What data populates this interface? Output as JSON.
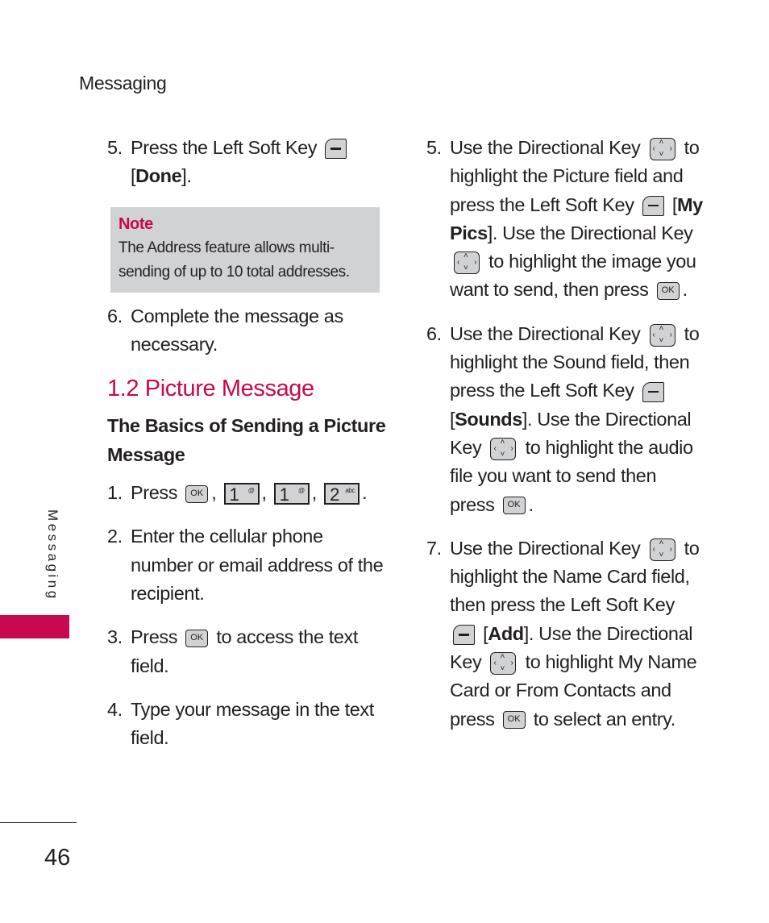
{
  "header": {
    "title": "Messaging"
  },
  "left_column": {
    "step5": {
      "num": "5.",
      "text_a": "Press the Left Soft Key",
      "bracket_open": "[",
      "label": "Done",
      "bracket_close": "]."
    },
    "note": {
      "title": "Note",
      "text": "The Address feature allows multi-sending of up to 10 total addresses."
    },
    "step6": {
      "num": "6.",
      "text": "Complete the message as necessary."
    },
    "section_title": "1.2 Picture Message",
    "subsection_title": "The Basics of Sending a Picture Message",
    "step1": {
      "num": "1.",
      "text": "Press",
      "sep": ",",
      "end": "."
    },
    "step2": {
      "num": "2.",
      "text": "Enter the cellular phone number or email address of the recipient."
    },
    "step3": {
      "num": "3.",
      "text_a": "Press",
      "text_b": "to access the text field."
    },
    "step4": {
      "num": "4.",
      "text": "Type your message in the text field."
    }
  },
  "right_column": {
    "step5": {
      "num": "5.",
      "a": "Use the Directional Key",
      "b": "to highlight the Picture field and press the Left Soft Key",
      "label": "My Pics",
      "c": ". Use the Directional Key",
      "d": "to highlight the image you want to send, then press",
      "e": "."
    },
    "step6": {
      "num": "6.",
      "a": "Use the Directional Key",
      "b": "to highlight the Sound field, then press the Left Soft Key",
      "label": "Sounds",
      "c": ". Use the Directional Key",
      "d": "to highlight the audio file you want to send then press",
      "e": "."
    },
    "step7": {
      "num": "7.",
      "a": "Use the Directional Key",
      "b": "to highlight the Name Card field, then press the Left Soft Key",
      "label": "Add",
      "c": ". Use the Directional Key",
      "d": "to highlight My Name Card or From Contacts and press",
      "e": "to select an entry."
    }
  },
  "keys": {
    "ok": "OK",
    "one": "1",
    "one_sub": "@",
    "two": "2",
    "two_sub": "abc",
    "up": "˄",
    "down": "˅",
    "left": "‹",
    "right": "›"
  },
  "sidebar": {
    "label": "Messaging"
  },
  "footer": {
    "page_number": "46"
  },
  "colors": {
    "accent": "#c8084f",
    "note_bg": "#d1d2d4"
  }
}
